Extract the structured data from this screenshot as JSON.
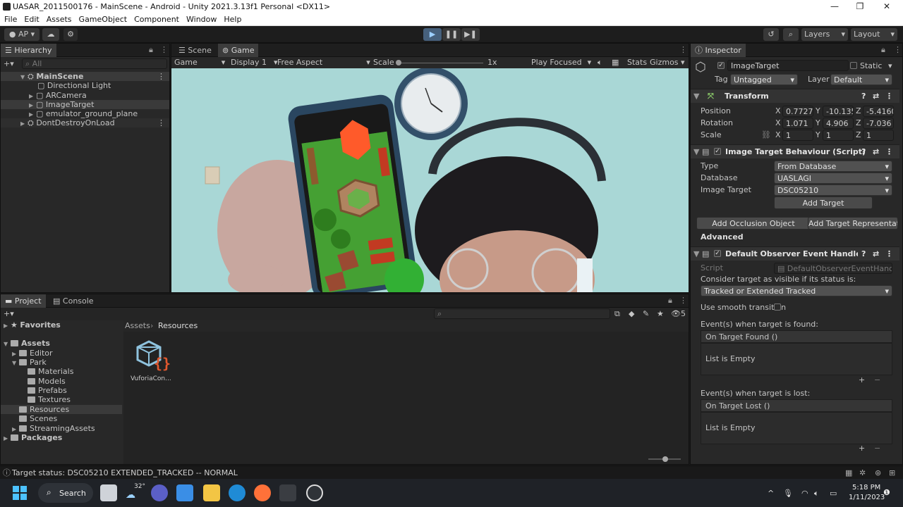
{
  "window": {
    "title": "UASAR_2011500176 - MainScene - Android - Unity 2021.3.13f1 Personal <DX11>",
    "controls": {
      "minimize": "—",
      "maximize": "❐",
      "close": "✕"
    }
  },
  "menu": [
    "File",
    "Edit",
    "Assets",
    "GameObject",
    "Component",
    "Window",
    "Help"
  ],
  "toolbar": {
    "account": "AP",
    "layers": "Layers",
    "layout": "Layout"
  },
  "hierarchy": {
    "tab": "Hierarchy",
    "search_placeholder": "All",
    "items": [
      {
        "label": "MainScene"
      },
      {
        "label": "Directional Light"
      },
      {
        "label": "ARCamera"
      },
      {
        "label": "ImageTarget"
      },
      {
        "label": "emulator_ground_plane"
      },
      {
        "label": "DontDestroyOnLoad"
      }
    ]
  },
  "view": {
    "tabs": [
      "Scene",
      "Game"
    ],
    "game_dropdown": "Game",
    "display": "Display 1",
    "aspect": "Free Aspect",
    "scale_label": "Scale",
    "scale_value": "1x",
    "play_mode": "Play Focused",
    "stats": "Stats",
    "gizmos": "Gizmos"
  },
  "inspector": {
    "tab": "Inspector",
    "object_name": "ImageTarget",
    "static": "Static",
    "tag_label": "Tag",
    "tag": "Untagged",
    "layer_label": "Layer",
    "layer": "Default",
    "transform": {
      "title": "Transform",
      "position_label": "Position",
      "rotation_label": "Rotation",
      "scale_label": "Scale",
      "position": {
        "x": "0.77275",
        "y": "-10.135",
        "z": "-5.4160"
      },
      "rotation": {
        "x": "1.071",
        "y": "4.906",
        "z": "-7.036"
      },
      "scale": {
        "x": "1",
        "y": "1",
        "z": "1"
      }
    },
    "image_target": {
      "title": "Image Target Behaviour (Script)",
      "type_label": "Type",
      "type": "From Database",
      "database_label": "Database",
      "database": "UASLAGI",
      "image_target_label": "Image Target",
      "image_target": "DSC05210",
      "add_target": "Add Target",
      "add_occlusion": "Add Occlusion Object",
      "add_representation": "Add Target Representation",
      "advanced": "Advanced"
    },
    "observer": {
      "title": "Default Observer Event Handler (Script)",
      "script_label": "Script",
      "script": "DefaultObserverEventHandle",
      "consider_label": "Consider target as visible if its status is:",
      "status": "Tracked or Extended Tracked",
      "smooth_label": "Use smooth transition",
      "found_label": "Event(s) when target is found:",
      "found_event": "On Target Found ()",
      "found_empty": "List is Empty",
      "lost_label": "Event(s) when target is lost:",
      "lost_event": "On Target Lost ()",
      "lost_empty": "List is Empty"
    }
  },
  "project": {
    "tabs": [
      "Project",
      "Console"
    ],
    "breadcrumb": [
      "Assets",
      "Resources"
    ],
    "favorites": "Favorites",
    "tree": [
      {
        "label": "Assets"
      },
      {
        "label": "Editor"
      },
      {
        "label": "Park"
      },
      {
        "label": "Materials"
      },
      {
        "label": "Models"
      },
      {
        "label": "Prefabs"
      },
      {
        "label": "Textures"
      },
      {
        "label": "Resources"
      },
      {
        "label": "Scenes"
      },
      {
        "label": "StreamingAssets"
      },
      {
        "label": "Packages"
      }
    ],
    "asset_name": "VuforiaCon...",
    "hidden_count": "5"
  },
  "status_bar": "Target status: DSC05210 EXTENDED_TRACKED -- NORMAL",
  "taskbar": {
    "search": "Search",
    "weather": "32°",
    "time": "5:18 PM",
    "date": "1/11/2023"
  }
}
